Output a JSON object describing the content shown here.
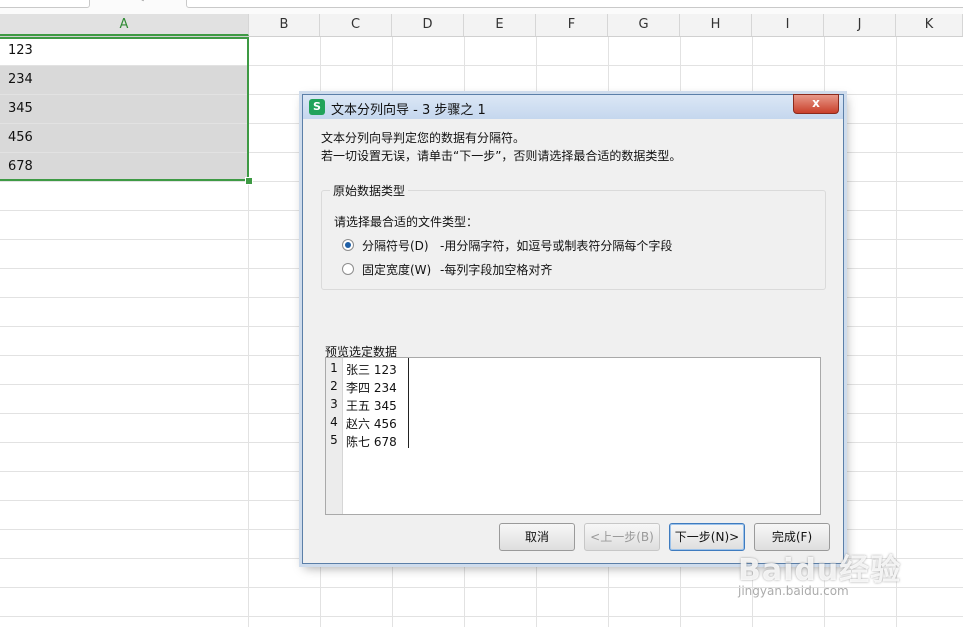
{
  "columns": [
    "A",
    "B",
    "C",
    "D",
    "E",
    "F",
    "G",
    "H",
    "I",
    "J",
    "K"
  ],
  "cells_A": [
    "123",
    "234",
    "345",
    "456",
    "678"
  ],
  "dialog": {
    "title": "文本分列向导 - 3 步骤之 1",
    "app_icon": "S",
    "close_label": "x",
    "intro_line1": "文本分列向导判定您的数据有分隔符。",
    "intro_line2": "若一切设置无误，请单击“下一步”，否则请选择最合适的数据类型。",
    "group_label": "原始数据类型",
    "prompt": "请选择最合适的文件类型：",
    "option_delimited": {
      "label": "分隔符号(D)",
      "desc": "-用分隔字符，如逗号或制表符分隔每个字段",
      "checked": true
    },
    "option_fixed": {
      "label": "固定宽度(W)",
      "desc": "-每列字段加空格对齐",
      "checked": false
    },
    "preview_label": "预览选定数据",
    "preview_rows": [
      {
        "num": "1",
        "text": "张三 123"
      },
      {
        "num": "2",
        "text": "李四 234"
      },
      {
        "num": "3",
        "text": "王五 345"
      },
      {
        "num": "4",
        "text": "赵六 456"
      },
      {
        "num": "5",
        "text": "陈七 678"
      }
    ],
    "buttons": {
      "cancel": "取消",
      "back": "<上一步(B)",
      "next": "下一步(N)>",
      "finish": "完成(F)"
    }
  },
  "watermark": {
    "brand": "Baidu经验",
    "url": "jingyan.baidu.com"
  },
  "colors": {
    "accent_green": "#3e9a44",
    "selection_gray": "#d9d9d9",
    "dialog_bg": "#f0f0f0"
  }
}
